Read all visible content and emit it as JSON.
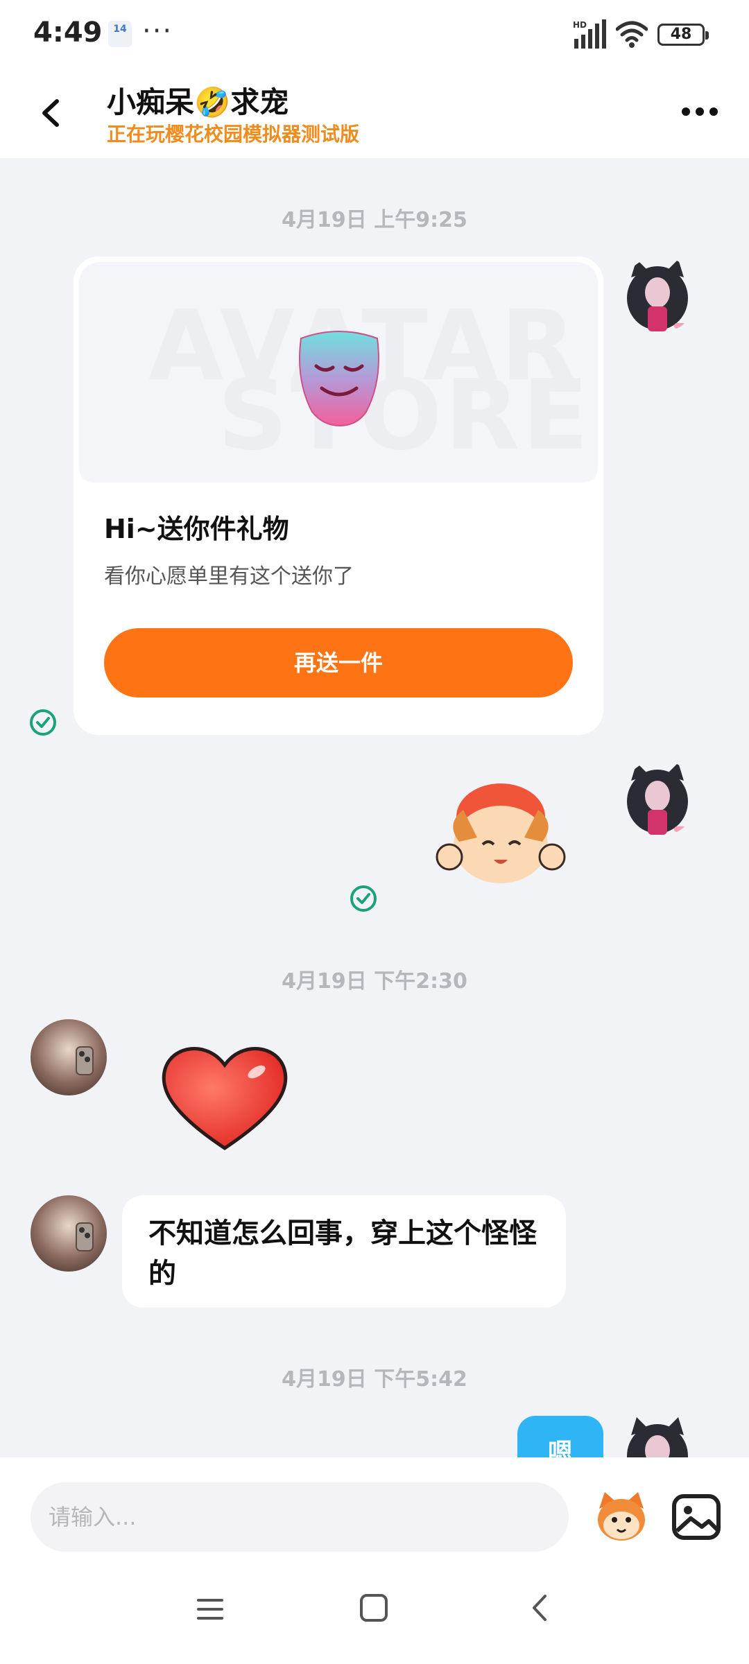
{
  "status_bar": {
    "time": "4:49",
    "calendar_day": "14",
    "overflow": "···",
    "network": "HD",
    "battery": "48"
  },
  "header": {
    "title": "小痴呆🤣求宠",
    "subtitle": "正在玩樱花校园模拟器测试版",
    "back_icon": "chevron-left-icon",
    "more_icon": "more-horizontal-icon"
  },
  "messages": {
    "timestamp_1": "4月19日 上午9:25",
    "gift": {
      "watermark_line1": "AVATAR",
      "watermark_line2": "STORE",
      "title": "Hi~送你件礼物",
      "desc": "看你心愿单里有这个送你了",
      "button": "再送一件"
    },
    "timestamp_2": "4月19日 下午2:30",
    "text_1": "不知道怎么回事，穿上这个怪怪的",
    "timestamp_3": "4月19日 下午5:42",
    "partial_bubble": "嗯"
  },
  "input": {
    "placeholder": "请输入..."
  },
  "colors": {
    "accent_orange": "#fe7414",
    "subtitle_orange": "#f08c1e",
    "blue_bubble": "#2fb4f6",
    "check_green": "#1aa37a",
    "background": "#f2f3f7"
  }
}
